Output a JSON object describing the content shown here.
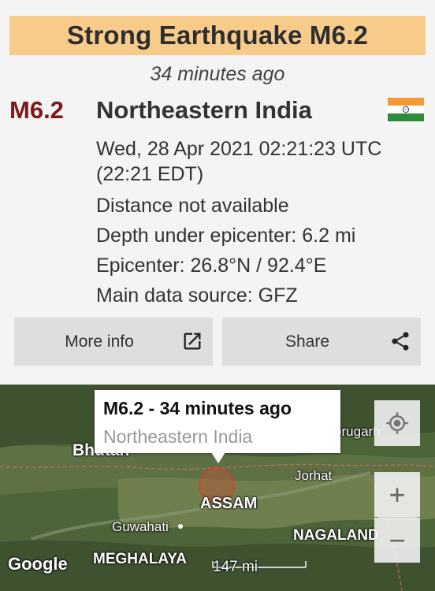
{
  "header": {
    "title": "Strong Earthquake M6.2",
    "time_ago": "34 minutes ago"
  },
  "quake": {
    "magnitude": "M6.2",
    "region": "Northeastern India",
    "flag_icon": "india-flag-icon",
    "date_line1": "Wed, 28 Apr 2021 02:21:23 UTC",
    "date_line2": "(22:21 EDT)",
    "distance": "Distance not available",
    "depth": "Depth under epicenter: 6.2 mi",
    "epicenter": "Epicenter: 26.8°N / 92.4°E",
    "source": "Main data source: GFZ"
  },
  "buttons": {
    "more_info": "More info",
    "more_info_icon": "open-external-icon",
    "share": "Share",
    "share_icon": "share-icon"
  },
  "map": {
    "popup_title": "M6.2  -  34 minutes ago",
    "popup_subtitle": "Northeastern India",
    "labels": {
      "bhutan": "Bhutan",
      "dibrugarh": "Dibrugarh",
      "jorhat": "Jorhat",
      "assam": "ASSAM",
      "guwahati": "Guwahati",
      "nagaland": "NAGALAND",
      "meghalaya": "MEGHALAYA"
    },
    "scale": "147 mi",
    "attribution": "Google",
    "controls": {
      "locate_icon": "my-location-icon",
      "zoom_in": "+",
      "zoom_out": "−"
    }
  },
  "colors": {
    "banner": "#f7cb8a",
    "magnitude": "#7b1a1a",
    "epicenter_marker": "#d9302b"
  }
}
